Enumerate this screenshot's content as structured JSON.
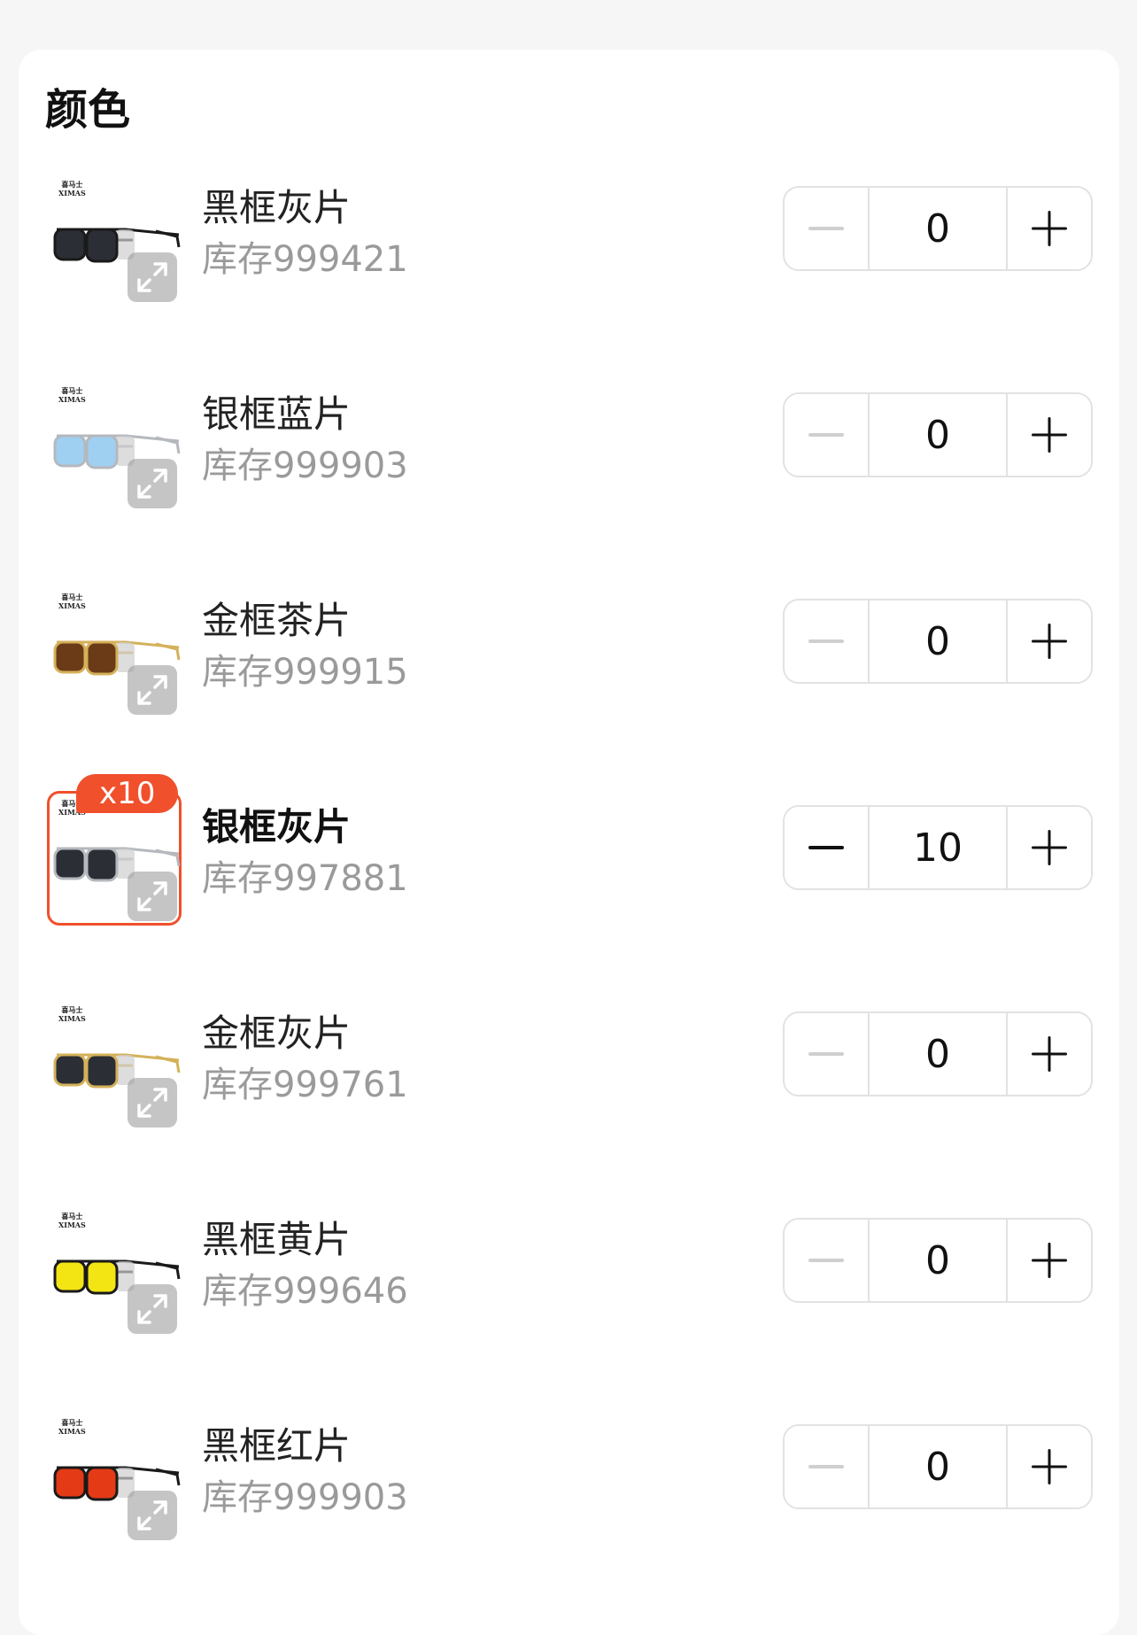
{
  "section": {
    "title": "颜色"
  },
  "brand": {
    "cn": "喜马士",
    "en": "XIMAS"
  },
  "variants": [
    {
      "name": "黑框灰片",
      "stock": "库存999421",
      "qty": "0",
      "frame": "#1a1a1a",
      "lens": "#2b2e35",
      "selected": false
    },
    {
      "name": "银框蓝片",
      "stock": "库存999903",
      "qty": "0",
      "frame": "#b5b8bd",
      "lens": "#9fd0f2",
      "selected": false
    },
    {
      "name": "金框茶片",
      "stock": "库存999915",
      "qty": "0",
      "frame": "#d4b15a",
      "lens": "#6b3b18",
      "selected": false
    },
    {
      "name": "银框灰片",
      "stock": "库存997881",
      "qty": "10",
      "badge": "x10",
      "frame": "#b5b8bd",
      "lens": "#2b2e35",
      "selected": true
    },
    {
      "name": "金框灰片",
      "stock": "库存999761",
      "qty": "0",
      "frame": "#d4b15a",
      "lens": "#2b2e35",
      "selected": false
    },
    {
      "name": "黑框黄片",
      "stock": "库存999646",
      "qty": "0",
      "frame": "#1a1a1a",
      "lens": "#f3e414",
      "selected": false
    },
    {
      "name": "黑框红片",
      "stock": "库存999903",
      "qty": "0",
      "frame": "#1a1a1a",
      "lens": "#e43a16",
      "selected": false
    }
  ],
  "colors": {
    "accent": "#f0502c",
    "disabled": "#cfcfcf",
    "active": "#111111"
  }
}
